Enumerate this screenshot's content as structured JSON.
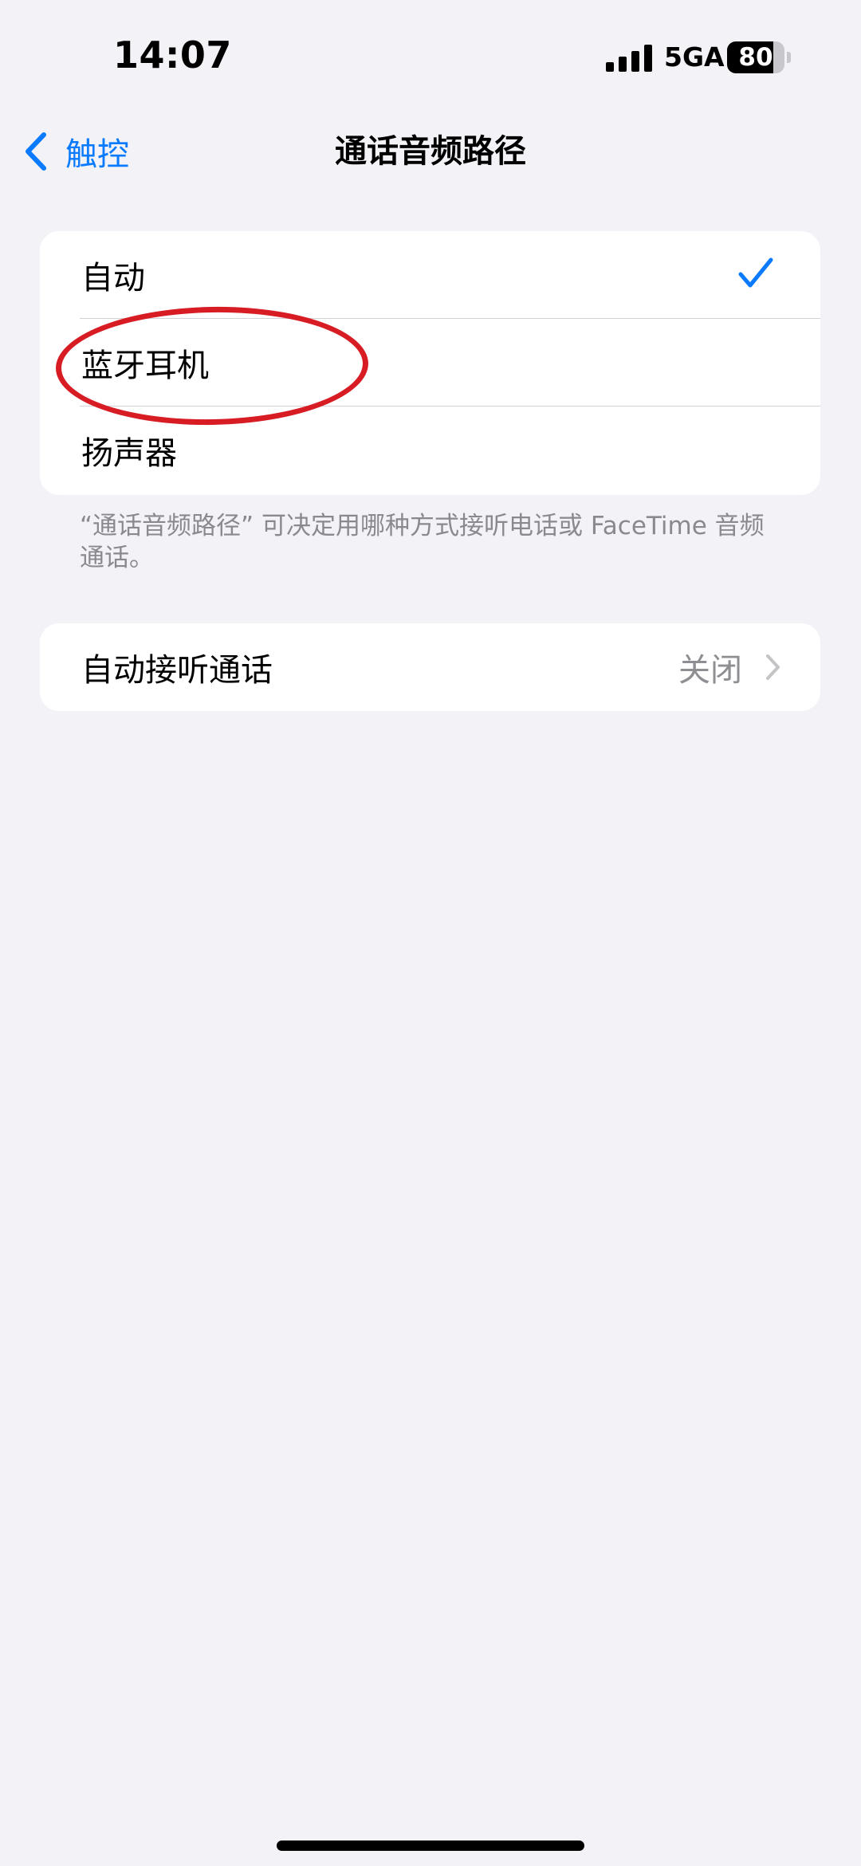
{
  "status_bar": {
    "time": "14:07",
    "network": "5GA",
    "battery_level": 80,
    "battery_text": "80",
    "signal_icon": "cellular-signal-icon"
  },
  "nav": {
    "back_label": "触控",
    "back_icon": "chevron-left-icon",
    "title": "通话音频路径"
  },
  "routes": {
    "options": [
      {
        "label": "自动",
        "selected": true
      },
      {
        "label": "蓝牙耳机",
        "selected": false
      },
      {
        "label": "扬声器",
        "selected": false
      }
    ],
    "check_icon": "checkmark-icon",
    "footer": "“通话音频路径” 可决定用哪种方式接听电话或 FaceTime 音频通话。"
  },
  "auto_answer": {
    "label": "自动接听通话",
    "value": "关闭",
    "chevron_icon": "chevron-right-icon"
  },
  "annotation": {
    "highlighted_option": "蓝牙耳机",
    "color": "#d71c24"
  },
  "colors": {
    "accent": "#0a7aff",
    "background": "#f2f2f7",
    "secondary_text": "#8e8e93"
  }
}
